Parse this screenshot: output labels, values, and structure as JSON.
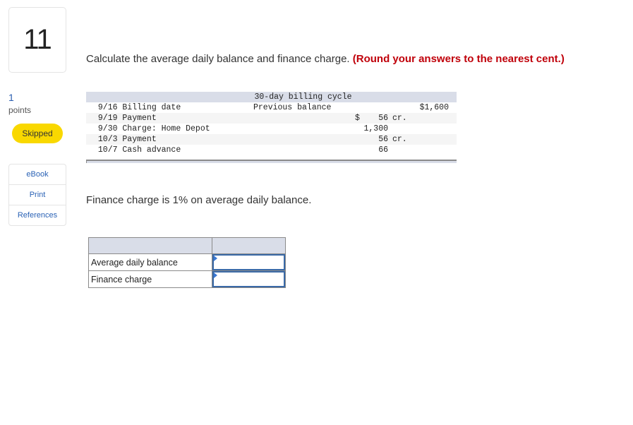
{
  "question": {
    "number": "11",
    "points_value": "1",
    "points_label": "points",
    "status": "Skipped"
  },
  "resources": [
    {
      "label": "eBook"
    },
    {
      "label": "Print"
    },
    {
      "label": "References"
    }
  ],
  "instructions": {
    "text": "Calculate the average daily balance and finance charge.",
    "emphasis": "(Round your answers to the nearest cent.)"
  },
  "billing": {
    "title": "30-day billing cycle",
    "rows": [
      {
        "date": "9/16",
        "description": "Billing date",
        "middle": "Previous balance",
        "currency": "",
        "amount": "",
        "cr": "",
        "right": "$1,600"
      },
      {
        "date": "9/19",
        "description": "Payment",
        "middle": "",
        "currency": "$",
        "amount": "56",
        "cr": "cr.",
        "right": ""
      },
      {
        "date": "9/30",
        "description": "Charge: Home Depot",
        "middle": "",
        "currency": "",
        "amount": "1,300",
        "cr": "",
        "right": ""
      },
      {
        "date": "10/3",
        "description": "Payment",
        "middle": "",
        "currency": "",
        "amount": "56",
        "cr": "cr.",
        "right": ""
      },
      {
        "date": "10/7",
        "description": "Cash advance",
        "middle": "",
        "currency": "",
        "amount": "66",
        "cr": "",
        "right": ""
      }
    ]
  },
  "finance_note": "Finance charge is 1% on average daily balance.",
  "answer_table": {
    "rows": [
      {
        "label": "Average daily balance",
        "value": ""
      },
      {
        "label": "Finance charge",
        "value": ""
      }
    ]
  }
}
